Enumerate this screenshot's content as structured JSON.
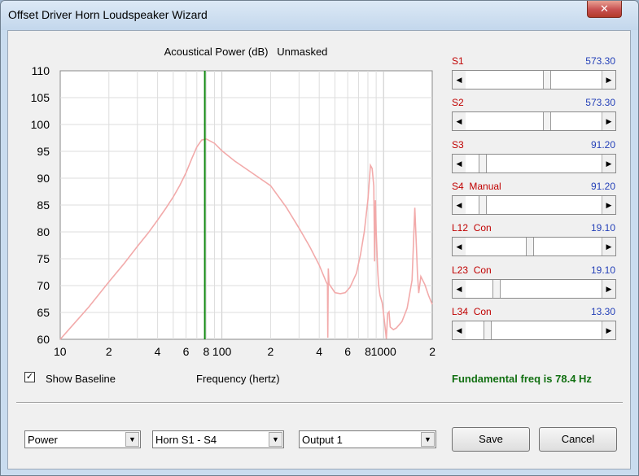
{
  "window": {
    "title": "Offset Driver Horn Loudspeaker Wizard",
    "close_glyph": "✕"
  },
  "chart_data": {
    "type": "line",
    "title": "Acoustical Power (dB)   Unmasked",
    "xlabel": "Frequency (hertz)",
    "ylabel": "",
    "xscale": "log",
    "xlim": [
      10,
      2000
    ],
    "ylim": [
      60,
      110
    ],
    "y_ticks": [
      110,
      105,
      100,
      95,
      90,
      85,
      80,
      75,
      70,
      65,
      60
    ],
    "x_tick_labels": [
      {
        "value": 10,
        "label": "10"
      },
      {
        "value": 20,
        "label": "2"
      },
      {
        "value": 40,
        "label": "4"
      },
      {
        "value": 60,
        "label": "6"
      },
      {
        "value": 80,
        "label": "8"
      },
      {
        "value": 100,
        "label": "100"
      },
      {
        "value": 200,
        "label": "2"
      },
      {
        "value": 400,
        "label": "4"
      },
      {
        "value": 600,
        "label": "6"
      },
      {
        "value": 800,
        "label": "8"
      },
      {
        "value": 1000,
        "label": "1000"
      },
      {
        "value": 2000,
        "label": "2"
      }
    ],
    "grid": true,
    "series_color": "#f2aaaa",
    "marker": {
      "frequency": 78.4,
      "color": "#118811"
    },
    "series": [
      {
        "x": [
          10,
          12,
          15,
          20,
          25,
          30,
          35,
          40,
          45,
          50,
          55,
          60,
          65,
          70,
          75,
          80,
          90,
          100,
          120,
          150,
          200,
          250,
          300,
          350,
          400,
          440,
          450,
          452,
          455,
          460,
          480,
          500,
          540,
          580,
          620,
          680,
          720,
          760,
          800,
          830,
          850,
          870,
          880,
          890,
          900,
          910,
          920,
          930,
          950,
          980,
          1000,
          1020,
          1040,
          1060,
          1080,
          1100,
          1150,
          1200,
          1300,
          1400,
          1500,
          1560,
          1600,
          1620,
          1650,
          1700,
          1800,
          1900,
          2000
        ],
        "y": [
          60,
          62.7,
          66,
          70.7,
          74.2,
          77.3,
          79.8,
          82.2,
          84.4,
          86.5,
          88.7,
          91,
          93.6,
          95.8,
          97.1,
          97.3,
          96.5,
          95.1,
          93.2,
          91.2,
          88.6,
          84.6,
          80.7,
          77.2,
          73.8,
          70.8,
          70.2,
          60.3,
          73.2,
          70.3,
          69.5,
          68.7,
          68.5,
          68.7,
          69.7,
          72.3,
          75.8,
          80,
          86,
          92.4,
          91.8,
          88.5,
          74.5,
          85.9,
          80.3,
          76.3,
          72.8,
          70.3,
          68.2,
          66.8,
          64.8,
          62.5,
          60.1,
          64.8,
          65.1,
          62.3,
          61.8,
          62.1,
          63.3,
          65.8,
          71,
          84.5,
          76.3,
          72.3,
          68.6,
          71.7,
          70.2,
          68.1,
          66.5
        ]
      }
    ]
  },
  "sliders": [
    {
      "label": "S1",
      "value": "573.30",
      "position": 0.6
    },
    {
      "label": "S2",
      "value": "573.30",
      "position": 0.6
    },
    {
      "label": "S3",
      "value": "91.20",
      "position": 0.1
    },
    {
      "label": "S4  Manual",
      "value": "91.20",
      "position": 0.1
    },
    {
      "label": "L12  Con",
      "value": "19.10",
      "position": 0.47
    },
    {
      "label": "L23  Con",
      "value": "19.10",
      "position": 0.21
    },
    {
      "label": "L34  Con",
      "value": "13.30",
      "position": 0.14
    }
  ],
  "baseline": {
    "label": "Show Baseline",
    "checked": true,
    "check_glyph": "✓"
  },
  "status": {
    "fundamental": "Fundamental freq is 78.4 Hz"
  },
  "dropdowns": {
    "quantity": "Power",
    "horn": "Horn S1 - S4",
    "output": "Output 1",
    "arrow_glyph": "▼"
  },
  "buttons": {
    "save": "Save",
    "cancel": "Cancel"
  },
  "scroll_glyphs": {
    "left": "◀",
    "right": "▶"
  }
}
